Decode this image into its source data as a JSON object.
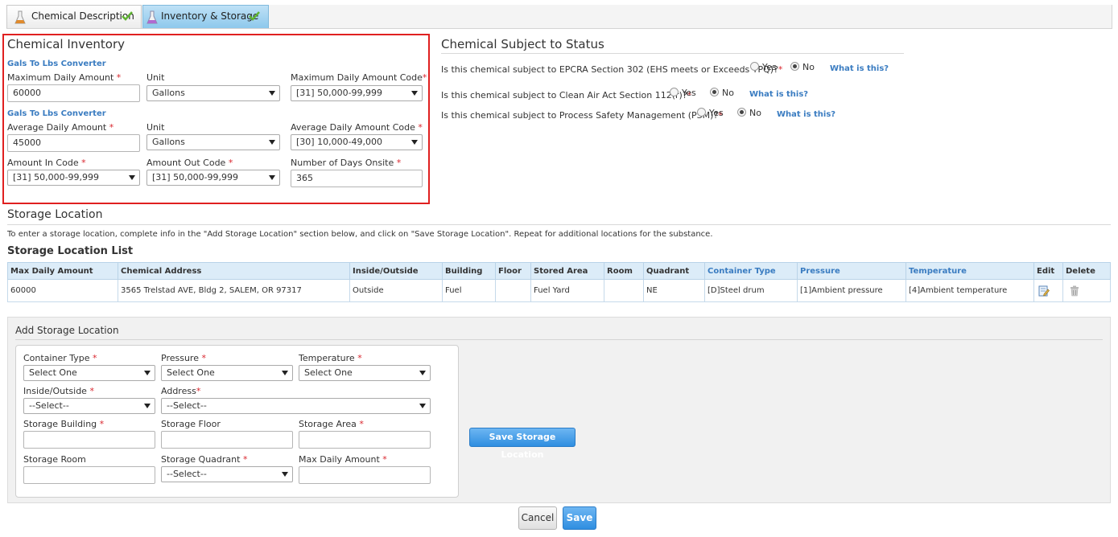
{
  "tabs": [
    {
      "label": "Chemical Description"
    },
    {
      "label": "Inventory & Storage"
    }
  ],
  "inventory": {
    "title": "Chemical Inventory",
    "converter_link": "Gals To Lbs Converter",
    "max_daily_amount": {
      "label": "Maximum Daily Amount",
      "value": "60000"
    },
    "unit1": {
      "label": "Unit",
      "value": "Gallons"
    },
    "max_daily_code": {
      "label": "Maximum Daily Amount Code",
      "value": "[31] 50,000-99,999"
    },
    "avg_daily_amount": {
      "label": "Average Daily Amount",
      "value": "45000"
    },
    "unit2": {
      "label": "Unit",
      "value": "Gallons"
    },
    "avg_daily_code": {
      "label": "Average Daily Amount Code",
      "value": "[30] 10,000-49,000"
    },
    "amount_in_code": {
      "label": "Amount In Code",
      "value": "[31] 50,000-99,999"
    },
    "amount_out_code": {
      "label": "Amount Out Code",
      "value": "[31] 50,000-99,999"
    },
    "days_onsite": {
      "label": "Number of Days Onsite",
      "value": "365"
    }
  },
  "status": {
    "title": "Chemical Subject to Status",
    "questions": [
      {
        "text": "Is this chemical subject to EPCRA Section 302 (EHS meets or Exceeds TPQ)?",
        "yes": "Yes",
        "no": "No",
        "selected": "No",
        "link": "What is this?"
      },
      {
        "text": "Is this chemical subject to Clean Air Act Section 112(r)?",
        "yes": "Yes",
        "no": "No",
        "selected": "No",
        "link": "What is this?"
      },
      {
        "text": "Is this chemical subject to Process Safety Management (PSM)?",
        "yes": "Yes",
        "no": "No",
        "selected": "No",
        "link": "What is this?"
      }
    ]
  },
  "storage": {
    "title": "Storage Location",
    "instructions": "To enter a storage location, complete info in the \"Add Storage Location\" section below, and click on \"Save Storage Location\". Repeat for additional locations for the substance.",
    "list_title": "Storage Location List",
    "columns": [
      "Max Daily Amount",
      "Chemical Address",
      "Inside/Outside",
      "Building",
      "Floor",
      "Stored Area",
      "Room",
      "Quadrant",
      "Container Type",
      "Pressure",
      "Temperature",
      "Edit",
      "Delete"
    ],
    "rows": [
      [
        "60000",
        "3565 Trelstad AVE, Bldg 2, SALEM, OR 97317",
        "Outside",
        "Fuel",
        "",
        "Fuel Yard",
        "",
        "NE",
        "[D]Steel drum",
        "[1]Ambient pressure",
        "[4]Ambient temperature"
      ]
    ]
  },
  "add_storage": {
    "title": "Add Storage Location",
    "container_type": {
      "label": "Container Type",
      "value": "Select One"
    },
    "pressure": {
      "label": "Pressure",
      "value": "Select One"
    },
    "temperature": {
      "label": "Temperature",
      "value": "Select One"
    },
    "inside_outside": {
      "label": "Inside/Outside",
      "value": "--Select--"
    },
    "address": {
      "label": "Address",
      "value": "--Select--"
    },
    "storage_building": {
      "label": "Storage Building"
    },
    "storage_floor": {
      "label": "Storage Floor"
    },
    "storage_area": {
      "label": "Storage Area"
    },
    "storage_room": {
      "label": "Storage Room"
    },
    "storage_quadrant": {
      "label": "Storage Quadrant",
      "value": "--Select--"
    },
    "max_daily_amount": {
      "label": "Max Daily Amount"
    },
    "save_button": "Save Storage Location"
  },
  "footer": {
    "cancel": "Cancel",
    "save": "Save"
  },
  "colors": {
    "accent": "#3a7cc1",
    "required": "#d9262e",
    "highlight_border": "#e02020",
    "button_blue": "#2f8ee0"
  }
}
